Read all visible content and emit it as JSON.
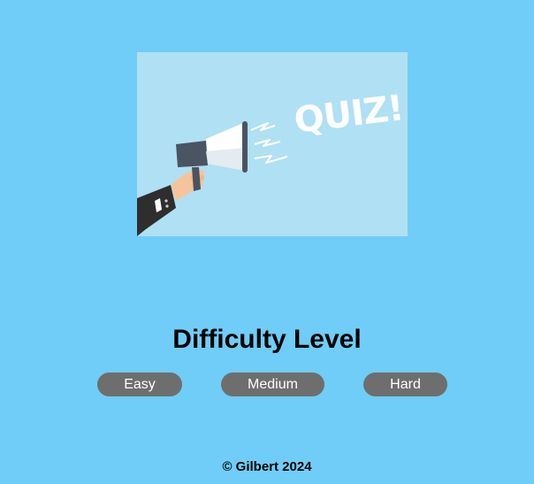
{
  "hero": {
    "badge_text": "QUIZ!",
    "colors": {
      "panel": "#b0e0f4",
      "megaphone_body": "#ffffff",
      "megaphone_dark": "#4a5463",
      "skin": "#f6c49c",
      "sleeve": "#2e2e2e"
    }
  },
  "difficulty": {
    "title": "Difficulty Level",
    "buttons": [
      {
        "label": "Easy"
      },
      {
        "label": "Medium"
      },
      {
        "label": "Hard"
      }
    ]
  },
  "footer": {
    "copyright_symbol": "©",
    "text": "Gilbert 2024"
  },
  "colors": {
    "background": "#70cdf7",
    "button_bg": "#6e6e6e",
    "button_text": "#ffffff"
  }
}
